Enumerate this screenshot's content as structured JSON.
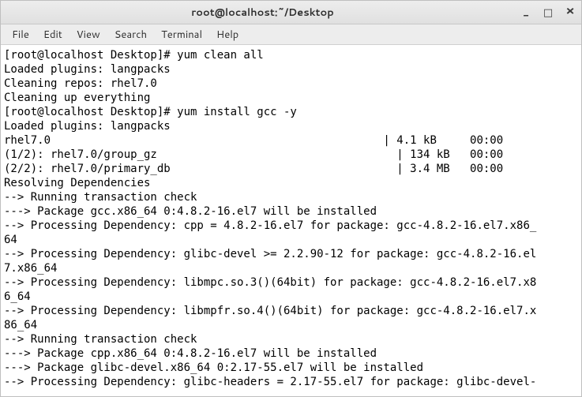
{
  "window": {
    "title": "root@localhost:~/Desktop"
  },
  "menubar": {
    "file": "File",
    "edit": "Edit",
    "view": "View",
    "search": "Search",
    "terminal": "Terminal",
    "help": "Help"
  },
  "terminal": {
    "content": "[root@localhost Desktop]# yum clean all\nLoaded plugins: langpacks\nCleaning repos: rhel7.0\nCleaning up everything\n[root@localhost Desktop]# yum install gcc -y\nLoaded plugins: langpacks\nrhel7.0                                                  | 4.1 kB     00:00\n(1/2): rhel7.0/group_gz                                    | 134 kB   00:00\n(2/2): rhel7.0/primary_db                                  | 3.4 MB   00:00\nResolving Dependencies\n--> Running transaction check\n---> Package gcc.x86_64 0:4.8.2-16.el7 will be installed\n--> Processing Dependency: cpp = 4.8.2-16.el7 for package: gcc-4.8.2-16.el7.x86_\n64\n--> Processing Dependency: glibc-devel >= 2.2.90-12 for package: gcc-4.8.2-16.el\n7.x86_64\n--> Processing Dependency: libmpc.so.3()(64bit) for package: gcc-4.8.2-16.el7.x8\n6_64\n--> Processing Dependency: libmpfr.so.4()(64bit) for package: gcc-4.8.2-16.el7.x\n86_64\n--> Running transaction check\n---> Package cpp.x86_64 0:4.8.2-16.el7 will be installed\n---> Package glibc-devel.x86_64 0:2.17-55.el7 will be installed\n--> Processing Dependency: glibc-headers = 2.17-55.el7 for package: glibc-devel-"
  },
  "winbuttons": {
    "minimize": "_",
    "maximize": "□",
    "close": "×"
  }
}
